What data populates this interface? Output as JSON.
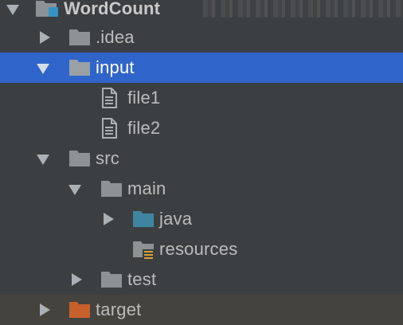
{
  "project_tree": {
    "root": {
      "label": "WordCount",
      "icon": "module-folder-icon",
      "expanded": true
    },
    "items": [
      {
        "label": ".idea",
        "icon": "folder-icon",
        "expanded": false
      },
      {
        "label": "input",
        "icon": "folder-icon",
        "expanded": true,
        "selected": true
      },
      {
        "label": "file1",
        "icon": "text-file-icon"
      },
      {
        "label": "file2",
        "icon": "text-file-icon"
      },
      {
        "label": "src",
        "icon": "folder-icon",
        "expanded": true
      },
      {
        "label": "main",
        "icon": "folder-icon",
        "expanded": true
      },
      {
        "label": "java",
        "icon": "source-root-folder-icon",
        "expanded": false
      },
      {
        "label": "resources",
        "icon": "resources-folder-icon"
      },
      {
        "label": "test",
        "icon": "folder-icon",
        "expanded": false
      },
      {
        "label": "target",
        "icon": "excluded-folder-icon",
        "expanded": false
      }
    ]
  },
  "colors": {
    "background": "#3c3f41",
    "selection": "#2f65ca",
    "excluded_row": "#45433d",
    "folder": "#8c9296",
    "source_folder": "#3e86a0",
    "excluded_folder": "#c8602b",
    "text": "#bbbbbb"
  }
}
